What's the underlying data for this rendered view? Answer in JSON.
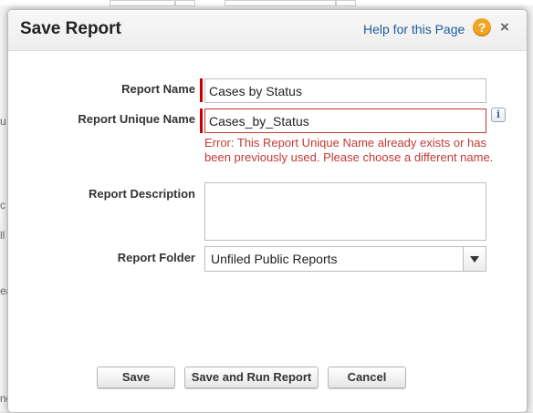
{
  "background": {
    "fragments": [
      "u",
      "c",
      "ll",
      "ea",
      "ne"
    ]
  },
  "dialog": {
    "title": "Save Report",
    "help_link": "Help for this Page",
    "help_icon": "?",
    "close_icon": "×",
    "accent_required": "#cc0000",
    "error_color": "#c23934"
  },
  "form": {
    "report_name": {
      "label": "Report Name",
      "value": "Cases by Status"
    },
    "report_unique_name": {
      "label": "Report Unique Name",
      "value": "Cases_by_Status",
      "info_icon": "i",
      "error": "Error: This Report Unique Name already exists or has been previously used. Please choose a different name."
    },
    "report_description": {
      "label": "Report Description",
      "value": ""
    },
    "report_folder": {
      "label": "Report Folder",
      "selected": "Unfiled Public Reports"
    }
  },
  "buttons": {
    "save": "Save",
    "save_and_run": "Save and Run Report",
    "cancel": "Cancel"
  }
}
